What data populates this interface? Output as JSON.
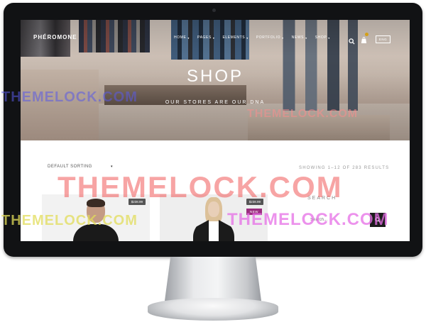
{
  "site": {
    "logo": "PHÉROMONE"
  },
  "nav": {
    "items": [
      {
        "label": "HOME"
      },
      {
        "label": "PAGES"
      },
      {
        "label": "ELEMENTS"
      },
      {
        "label": "PORTFOLIO"
      },
      {
        "label": "NEWS"
      },
      {
        "label": "SHOP"
      }
    ],
    "caret": "▾",
    "language": "ENG"
  },
  "hero": {
    "title": "SHOP",
    "subtitle": "OUR STORES ARE OUR DNA"
  },
  "shop": {
    "sorting": {
      "selected": "DEFAULT SORTING",
      "arrow": "▾"
    },
    "results": "SHOWING 1–12 OF 283 RESULTS",
    "products": [
      {
        "price": "$238.99"
      },
      {
        "price": "$238.99",
        "badge": "NEW"
      }
    ]
  },
  "sidebar": {
    "search_title": "SEARCH",
    "search_placeholder": "Search..."
  },
  "watermark": {
    "text": "THEMELOCK.COM"
  },
  "colors": {
    "badge_new": "#9b2d7f",
    "cart_badge": "#d4a017",
    "search_button": "#1c1c1c"
  }
}
